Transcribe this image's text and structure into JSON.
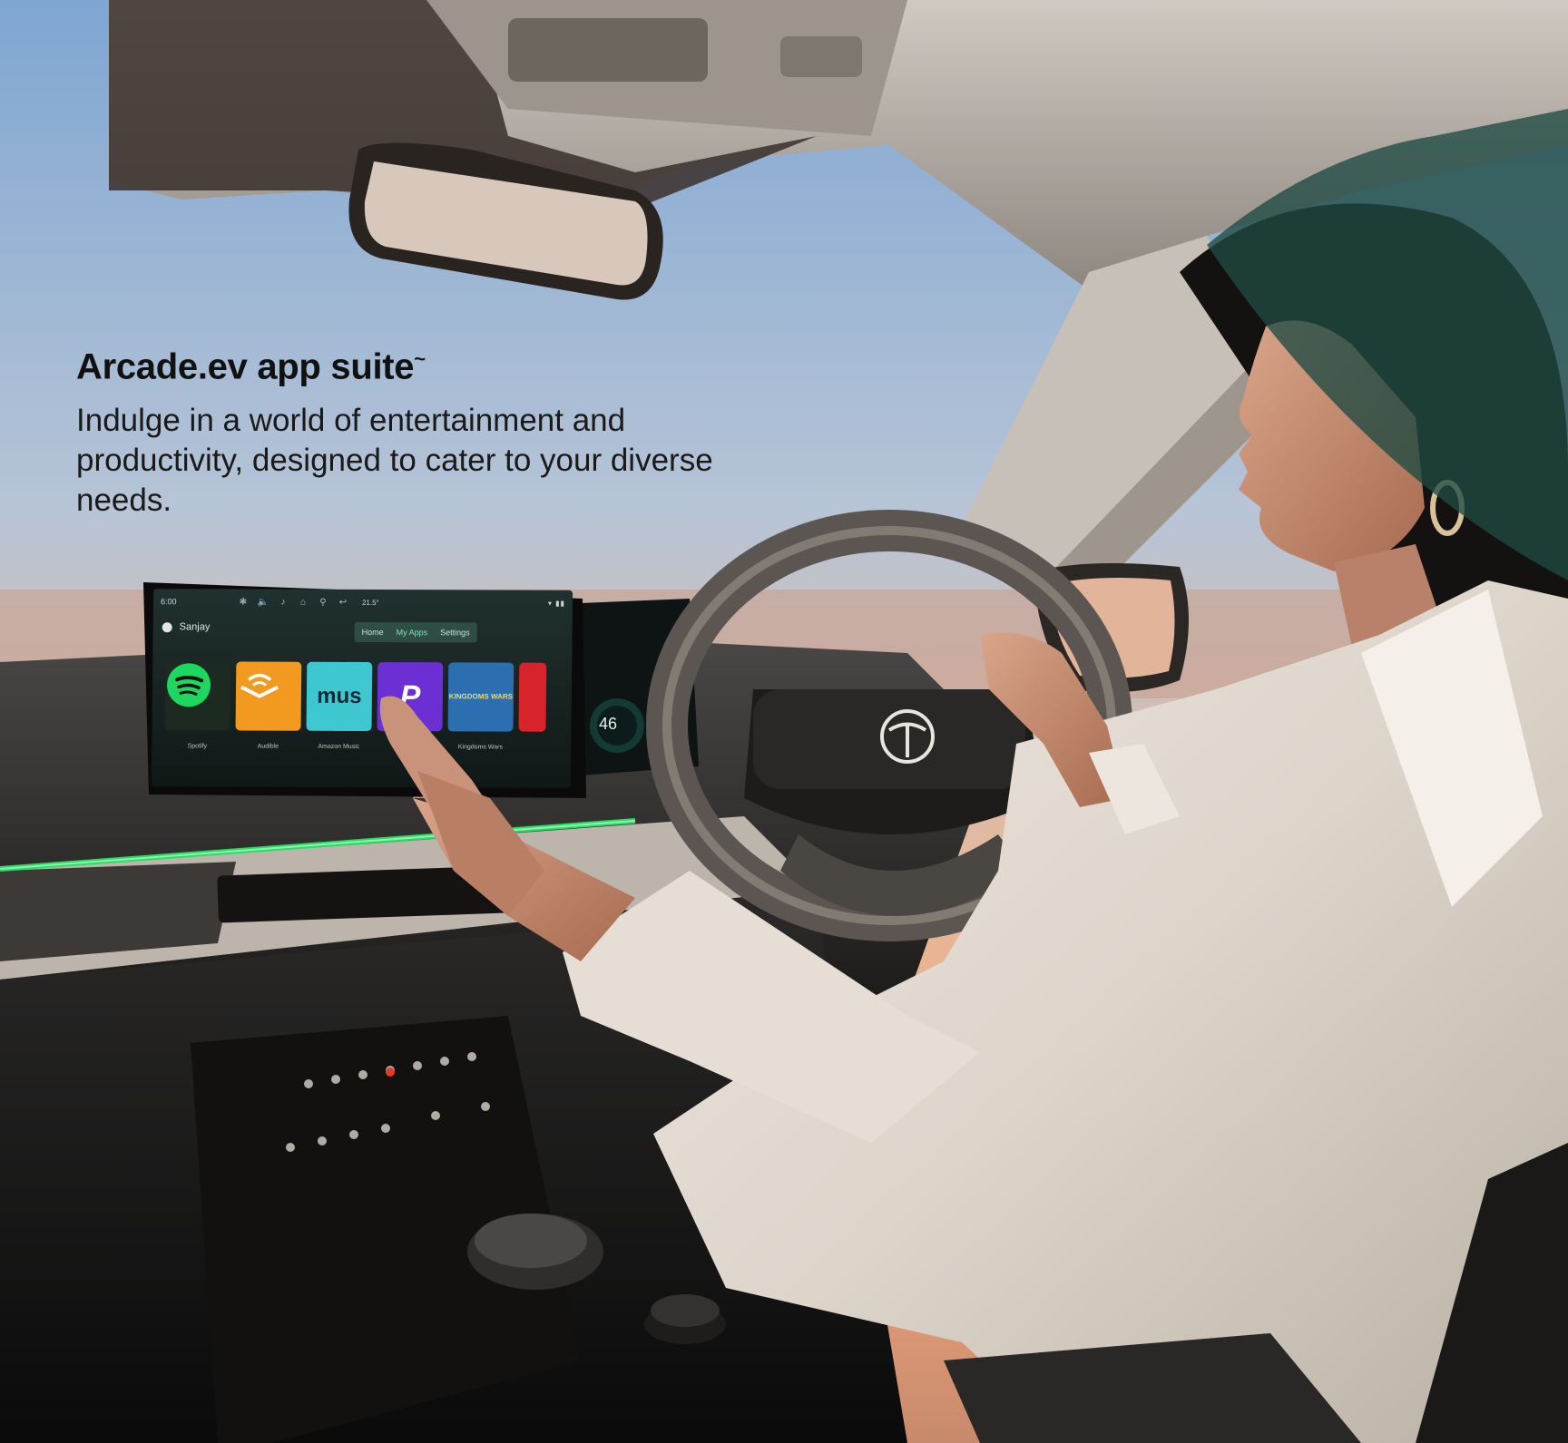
{
  "headline": {
    "title": "Arcade.ev app suite",
    "title_mark": "~",
    "body": "Indulge in a world of entertainment and productivity, designed to cater to your diverse needs."
  },
  "screen": {
    "time": "6:00",
    "temp": "21.5°",
    "user": "Sanjay",
    "tabs": [
      "Home",
      "My Apps",
      "Settings"
    ],
    "active_tab": "My Apps",
    "apps": [
      {
        "label": "Spotify",
        "color": "#1c2a22",
        "glyph": "spotify-icon"
      },
      {
        "label": "Audible",
        "color": "#f29a1f",
        "glyph": "audible-icon"
      },
      {
        "label": "Amazon Music",
        "color": "#3fc7cf",
        "glyph_text": "mus"
      },
      {
        "label": "",
        "color": "#6b2fd4",
        "glyph_text": "P"
      },
      {
        "label": "Kingdoms Wars",
        "color": "#2b6fb0",
        "glyph_text": "KINGDOMS WARS"
      },
      {
        "label": "",
        "color": "#d8232a",
        "glyph_text": ""
      }
    ],
    "cluster_value": "46"
  },
  "colors": {
    "sky_top": "#8fb3d6",
    "sky_bottom": "#e9b08a",
    "accent_teal": "#1f4a42",
    "ambient_green": "#31e06b"
  }
}
